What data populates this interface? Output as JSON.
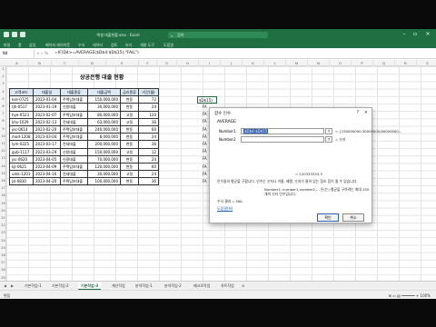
{
  "app": {
    "title": "엑셀 대출현황.xlsx - Excel",
    "search": "검색",
    "accent": "#1f6f43"
  },
  "ribbon": {
    "tabs": [
      "파일",
      "홈",
      "삽입",
      "페이지 레이아웃",
      "수식",
      "데이터",
      "검토",
      "보기",
      "개발 도구",
      "도움말"
    ]
  },
  "formula_bar": {
    "name_box": "N4",
    "fx": "× ✓ fx",
    "formula": "=IF(D4>=AVERAGE($D$4:$D$15),\"FAIL\")"
  },
  "columns": [
    "A",
    "B",
    "C",
    "D",
    "E",
    "F",
    "G",
    "H",
    "I",
    "J",
    "K",
    "L",
    "M",
    "N",
    "O",
    "P",
    "Q",
    "R",
    "S"
  ],
  "rows": [
    "1",
    "2",
    "3",
    "4",
    "5",
    "6",
    "7",
    "8",
    "9",
    "10",
    "11",
    "12",
    "13",
    "14",
    "15",
    "16",
    "17",
    "18",
    "19",
    "20",
    "21",
    "22",
    "23",
    "24",
    "25",
    "26",
    "27",
    "28",
    "29",
    "30",
    "31"
  ],
  "sheet": {
    "title": "상공은행 대출 현황",
    "headers": [
      "고객코드",
      "대출일",
      "대출종류",
      "대출금액",
      "금리종류",
      "기간(월)"
    ],
    "rows": [
      [
        "kse-0725",
        "2023-01-04",
        "주택담보대출",
        "150,000,000",
        "변동",
        "72"
      ],
      [
        "tjh-0517",
        "2023-01-19",
        "신용대출",
        "30,000,000",
        "변동",
        "24"
      ],
      [
        "hye-0523",
        "2023-02-07",
        "주택담보대출",
        "80,000,000",
        "고정",
        "120"
      ],
      [
        "khs-1029",
        "2023-02-13",
        "전세대출",
        "63,000,000",
        "고정",
        "36"
      ],
      [
        "jec-0614",
        "2023-02-20",
        "주택담보대출",
        "240,000,000",
        "변동",
        "60"
      ],
      [
        "mod-1208",
        "2023-03-04",
        "주택담보대출",
        "8,000,000",
        "변동",
        "24"
      ],
      [
        "lym-0225",
        "2023-03-17",
        "전세대출",
        "200,000,000",
        "변동",
        "36"
      ],
      [
        "gub-1117",
        "2023-03-29",
        "신용대출",
        "150,000,000",
        "고정",
        "12"
      ],
      [
        "jsc-0620",
        "2023-04-05",
        "신용대출",
        "70,000,000",
        "변동",
        "24"
      ],
      [
        "kjl-0621",
        "2023-04-09",
        "주택담보대출",
        "120,000,000",
        "변동",
        "60"
      ],
      [
        "umk-1201",
        "2023-04-16",
        "전세대출",
        "30,000,000",
        "고정",
        "24"
      ],
      [
        "jsl-0830",
        "2023-04-20",
        "주택담보대출",
        "100,000,000",
        "변동",
        "36"
      ]
    ]
  },
  "cell_editing": "$D$15)",
  "fa_column": [
    "FA",
    "FA",
    "FA",
    "FA",
    "FA",
    "FA",
    "FA",
    "FA",
    "FA",
    "FA",
    "FA"
  ],
  "dialog": {
    "title": "함수 인수",
    "function": "AVERAGE",
    "arg1_label": "Number1",
    "arg1_value": "$D$4:$D$15",
    "arg1_result": "= {150000000;30000000;80000000...",
    "arg2_label": "Number2",
    "arg2_result": "= 숫자",
    "result_line": "= 120333333.3",
    "description": "인수들의 평균을 구합니다. 인수는 숫자나 이름, 배열, 숫자가 들어 있는 참조 등이 될 수 있습니다.",
    "arg_help": "Number1: number1,number2,... 은(는) 평균을 구하려는 최대 255개의 숫자 인수입니다.",
    "formula_result": "수식 결과 = FAIL",
    "help_link": "도움말(H)",
    "ok": "확인",
    "cancel": "취소"
  },
  "sheet_tabs": [
    "기본작업-1",
    "기본작업-2",
    "기본작업-3",
    "계산작업",
    "분석작업-1",
    "분석작업-2",
    "매크로작업",
    "차트작업"
  ],
  "status": {
    "left": "편집",
    "right": "⊞ ▭ ▤ ━━━━━━ + 100%"
  }
}
